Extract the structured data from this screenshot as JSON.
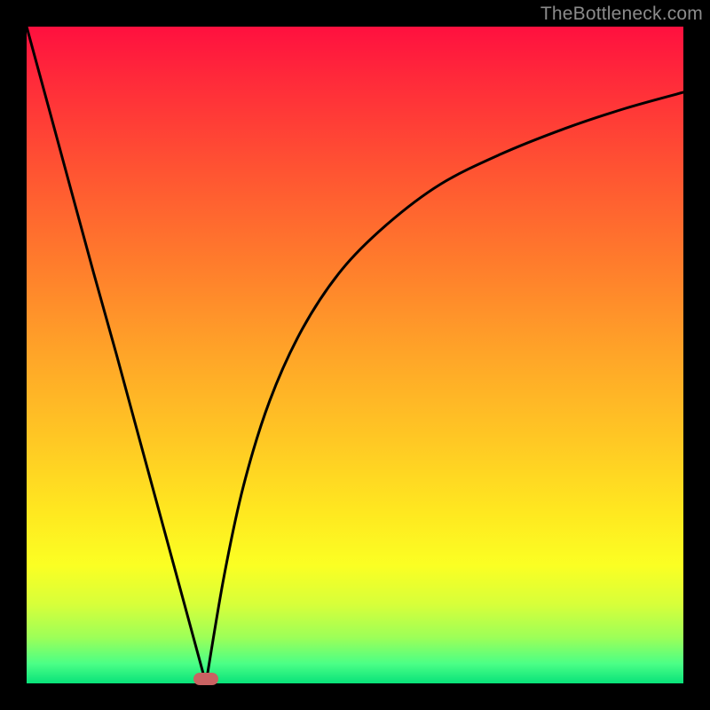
{
  "watermark": "TheBottleneck.com",
  "marker": {
    "x_frac": 0.273,
    "y_frac": 0.993,
    "color": "#c96262"
  },
  "chart_data": {
    "type": "line",
    "title": "",
    "xlabel": "",
    "ylabel": "",
    "xlim": [
      0,
      1
    ],
    "ylim": [
      0,
      1
    ],
    "grid": false,
    "legend": false,
    "series": [
      {
        "name": "left-branch",
        "x": [
          0.0,
          0.034,
          0.068,
          0.102,
          0.137,
          0.171,
          0.205,
          0.239,
          0.273
        ],
        "y": [
          1.0,
          0.875,
          0.75,
          0.625,
          0.5,
          0.375,
          0.25,
          0.125,
          0.0
        ]
      },
      {
        "name": "right-branch",
        "x": [
          0.273,
          0.3,
          0.33,
          0.37,
          0.42,
          0.48,
          0.55,
          0.63,
          0.72,
          0.82,
          0.91,
          1.0
        ],
        "y": [
          0.0,
          0.16,
          0.3,
          0.43,
          0.54,
          0.63,
          0.7,
          0.76,
          0.805,
          0.845,
          0.875,
          0.9
        ]
      }
    ],
    "annotations": []
  }
}
